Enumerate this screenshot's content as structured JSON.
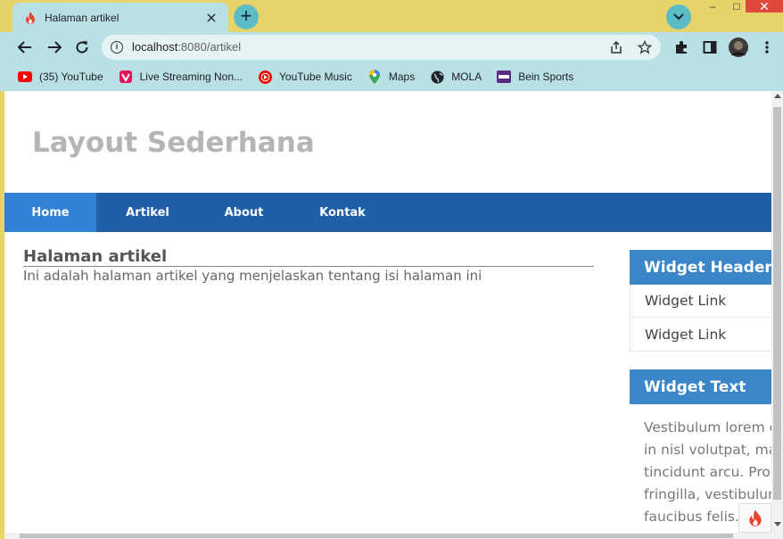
{
  "browser": {
    "tab": {
      "title": "Halaman artikel",
      "favicon": "codeigniter-flame-icon",
      "close": "×"
    },
    "new_tab": "+",
    "window_controls": {
      "minimize": "–",
      "maximize": "□",
      "close": "✕"
    },
    "url": {
      "host": "localhost",
      "path": ":8080/artikel"
    },
    "bookmarks": [
      {
        "label": "(35) YouTube",
        "icon": "youtube-icon",
        "color": "#ff0000"
      },
      {
        "label": "Live Streaming Non...",
        "icon": "vidio-icon",
        "color": "#e6135b"
      },
      {
        "label": "YouTube Music",
        "icon": "youtube-music-icon",
        "color": "#ff0000"
      },
      {
        "label": "Maps",
        "icon": "maps-pin-icon",
        "color": "#34a853"
      },
      {
        "label": "MOLA",
        "icon": "globe-icon",
        "color": "#202124"
      },
      {
        "label": "Bein Sports",
        "icon": "bein-sports-icon",
        "color": "#5a2d82"
      }
    ]
  },
  "page": {
    "site_title": "Layout Sederhana",
    "nav": [
      {
        "label": "Home",
        "active": true
      },
      {
        "label": "Artikel",
        "active": false
      },
      {
        "label": "About",
        "active": false
      },
      {
        "label": "Kontak",
        "active": false
      }
    ],
    "content": {
      "heading": "Halaman artikel",
      "body": "Ini adalah halaman artikel yang menjelaskan tentang isi halaman ini"
    },
    "sidebar": {
      "widget_header": "Widget Header",
      "links": [
        "Widget Link",
        "Widget Link"
      ],
      "widget_text_title": "Widget Text",
      "widget_text_lines": [
        "Vestibulum lorem e",
        "in nisl volutpat, ma",
        "tincidunt arcu. Proi",
        "fringilla, vestibulum",
        "faucibus felis."
      ]
    }
  },
  "colors": {
    "frame": "#e6d36a",
    "toolbar": "#b9e0e4",
    "nav_bg": "#1f5fa8",
    "nav_active": "#2f82d8",
    "widget_head": "#3a86c9",
    "title_gray": "#b5b5b5"
  }
}
